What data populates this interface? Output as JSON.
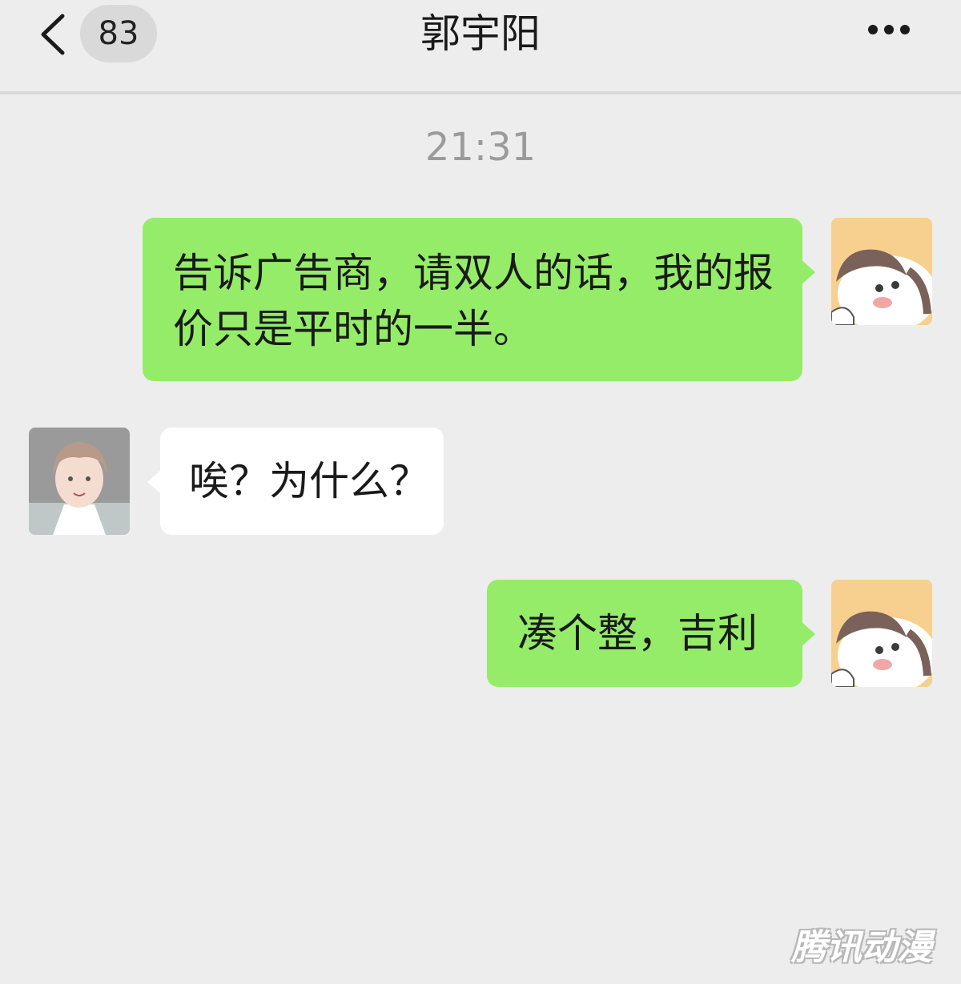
{
  "header": {
    "unread_count": "83",
    "title": "郭宇阳"
  },
  "timestamp": "21:31",
  "messages": [
    {
      "sender": "me",
      "text": "告诉广告商，请双人的话，我的报价只是平时的一半。"
    },
    {
      "sender": "other",
      "text": "唉？为什么？"
    },
    {
      "sender": "me",
      "text": "凑个整，吉利"
    }
  ],
  "watermark": "腾讯动漫",
  "colors": {
    "background": "#ededed",
    "outgoing_bubble": "#95ec69",
    "incoming_bubble": "#ffffff",
    "timestamp": "#9b9b9b"
  }
}
